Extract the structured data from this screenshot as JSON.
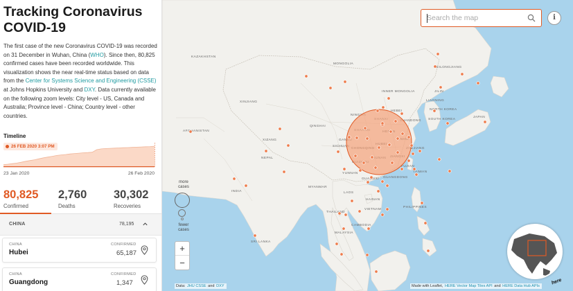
{
  "sidebar": {
    "title": "Tracking Coronavirus COVID-19",
    "intro": {
      "p1": "The first case of the new Coronavirus COVID-19 was recorded on 31 December in Wuhan, China (",
      "link_who": "WHO",
      "p2": "). Since then, 80,825 confirmed cases have been recorded worldwide. This visualization shows the near real-time status based on data from the ",
      "link_csse": "Center for Systems Science and Engineering (CSSE)",
      "p3": " at Johns Hopkins University and ",
      "link_dxy": "DXY",
      "p4": ". Data currently available on the following zoom levels: City level - US, Canada and Australia; Province level - China; Country level - other countries."
    },
    "timeline": {
      "label": "Timeline",
      "current_date": "26 FEB 2020 3:07 PM",
      "start_date": "23 Jan 2020",
      "end_date": "26 Feb 2020",
      "progress": [
        0.05,
        0.07,
        0.1,
        0.13,
        0.17,
        0.22,
        0.26,
        0.3,
        0.35,
        0.4,
        0.44,
        0.48,
        0.52,
        0.55,
        0.57,
        0.6,
        0.62,
        0.64,
        0.66,
        0.67,
        0.69,
        0.82,
        0.86,
        0.88,
        0.89,
        0.9,
        0.91,
        0.92,
        0.93,
        0.94,
        0.95,
        0.96,
        0.97,
        0.98,
        1.0
      ]
    },
    "stats": {
      "confirmed": {
        "value": "80,825",
        "label": "Confirmed"
      },
      "deaths": {
        "value": "2,760",
        "label": "Deaths"
      },
      "recoveries": {
        "value": "30,302",
        "label": "Recoveries"
      }
    },
    "region": {
      "name": "CHINA",
      "count": "78,195"
    },
    "cards": [
      {
        "country": "CHINA",
        "province": "Hubei",
        "confirmed_label": "CONFIRMED",
        "confirmed": "65,187"
      },
      {
        "country": "CHINA",
        "province": "Guangdong",
        "confirmed_label": "CONFIRMED",
        "confirmed": "1,347"
      }
    ]
  },
  "map": {
    "search_placeholder": "Search the map",
    "legend": {
      "more": "more cases",
      "fewer": "fewer cases"
    },
    "zoom_in": "+",
    "zoom_out": "−",
    "attribution_left": {
      "prefix": "Data:",
      "jhu": "JHU CSSE",
      "and": "and",
      "dxy": "DXY"
    },
    "attribution_right": {
      "prefix": "Made with Leaflet,",
      "here_vector": "HERE Vector Map Tiles API",
      "and": "and",
      "here_hub": "HERE Data Hub APIs"
    },
    "logo_text": "here",
    "labels": {
      "kazakhstan": "Kazakhstan",
      "mongolia": "Mongolia",
      "afghanistan": "Afghanistan",
      "nepal": "Nepal",
      "myanmar": "Myanmar",
      "thailand": "Thailand",
      "cambodia": "Cambodia",
      "sri_lanka": "Sri Lanka",
      "japan": "Japan",
      "south_korea": "South Korea",
      "north_korea": "North Korea",
      "philippines": "Philippines",
      "malaysia": "Malaysia",
      "laos": "Laos",
      "vietnam": "Vietnam",
      "india": "India",
      "xinjiang": "Xinjiang",
      "qinghai": "Qinghai",
      "gansu": "Gansu",
      "sichuan": "Sichuan",
      "yunnan": "Yunnan",
      "shaanxi": "Shaanxi",
      "inner_mongolia": "Inner Mongolia",
      "heilongjiang": "Heilongjiang",
      "jilin": "Jilin",
      "liaoning": "Liaoning",
      "hubei": "Hubei",
      "hunan": "Hunan",
      "guangxi": "Guangxi",
      "guangdong": "Guangdong",
      "chongqing": "Chongqing",
      "henan": "Henan",
      "anhui": "Anhui",
      "jiangxi": "Jiangxi",
      "zhejiang": "Zhejiang",
      "fujian": "Fujian",
      "shandong": "Shandong",
      "hebei": "Hebei",
      "shanxi": "Shanxi",
      "ningxia": "Ningxia",
      "xizang": "Xizang",
      "guizhou": "Guizhou",
      "taiwan": "Taiwan",
      "hainan": "Hainan"
    }
  },
  "colors": {
    "accent": "#e05a24",
    "water": "#a9d3ec",
    "land": "#f2f1ed",
    "bubble": "#f4a57e"
  }
}
